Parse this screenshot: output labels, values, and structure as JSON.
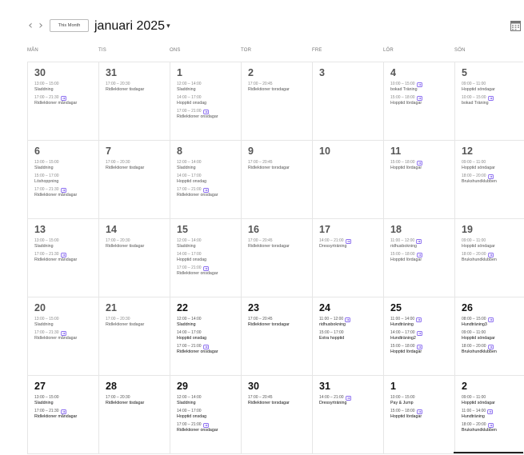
{
  "header": {
    "prev_label": "‹",
    "next_label": "›",
    "this_month_label": "This Month",
    "month_title": "januari 2025",
    "caret": "⌄"
  },
  "weekdays": [
    "MÅN",
    "TIS",
    "ONS",
    "TOR",
    "FRE",
    "LÖR",
    "SÖN"
  ],
  "colors": {
    "accent": "#8a6cf0",
    "grid": "#e6e6e6"
  },
  "weeks": [
    [
      {
        "day": "30",
        "dark": false,
        "events": [
          {
            "time": "13:00 – 15:00",
            "name": "Sladdning",
            "repeat": false
          },
          {
            "time": "17:00 – 21:30",
            "name": "Ridlektioner måndagar",
            "repeat": true
          }
        ]
      },
      {
        "day": "31",
        "dark": false,
        "events": [
          {
            "time": "17:00 – 20:30",
            "name": "Ridlektioner tisdagar",
            "repeat": false
          }
        ]
      },
      {
        "day": "1",
        "dark": false,
        "events": [
          {
            "time": "12:00 – 14:00",
            "name": "Sladdning",
            "repeat": false
          },
          {
            "time": "14:00 – 17:00",
            "name": "Hopptid onsdag",
            "repeat": false
          },
          {
            "time": "17:00 – 21:00",
            "name": "Ridlektioner onsdagar",
            "repeat": true
          }
        ]
      },
      {
        "day": "2",
        "dark": false,
        "events": [
          {
            "time": "17:00 – 20:45",
            "name": "Ridlektioner torsdagar",
            "repeat": false
          }
        ]
      },
      {
        "day": "3",
        "dark": false,
        "events": []
      },
      {
        "day": "4",
        "dark": false,
        "events": [
          {
            "time": "10:00 – 15:00",
            "name": "bokad Träning",
            "repeat": true
          },
          {
            "time": "15:00 – 18:00",
            "name": "Hopptid lördagar",
            "repeat": true
          }
        ]
      },
      {
        "day": "5",
        "dark": false,
        "events": [
          {
            "time": "09:00 – 11:00",
            "name": "Hopptid söndagar",
            "repeat": false
          },
          {
            "time": "10:00 – 15:00",
            "name": "bokad Träning",
            "repeat": true
          }
        ]
      }
    ],
    [
      {
        "day": "6",
        "dark": false,
        "events": [
          {
            "time": "13:00 – 15:00",
            "name": "Sladdning",
            "repeat": false
          },
          {
            "time": "15:00 – 17:00",
            "name": "Löshoppning",
            "repeat": false
          },
          {
            "time": "17:00 – 21:30",
            "name": "Ridlektioner måndagar",
            "repeat": true
          }
        ]
      },
      {
        "day": "7",
        "dark": false,
        "events": [
          {
            "time": "17:00 – 20:30",
            "name": "Ridlektioner tisdagar",
            "repeat": false
          }
        ]
      },
      {
        "day": "8",
        "dark": false,
        "events": [
          {
            "time": "12:00 – 14:00",
            "name": "Sladdning",
            "repeat": false
          },
          {
            "time": "14:00 – 17:00",
            "name": "Hopptid onsdag",
            "repeat": false
          },
          {
            "time": "17:00 – 21:00",
            "name": "Ridlektioner onsdagar",
            "repeat": true
          }
        ]
      },
      {
        "day": "9",
        "dark": false,
        "events": [
          {
            "time": "17:00 – 20:45",
            "name": "Ridlektioner torsdagar",
            "repeat": false
          }
        ]
      },
      {
        "day": "10",
        "dark": false,
        "events": []
      },
      {
        "day": "11",
        "dark": false,
        "events": [
          {
            "time": "15:00 – 18:00",
            "name": "Hopptid lördagar",
            "repeat": true
          }
        ]
      },
      {
        "day": "12",
        "dark": false,
        "events": [
          {
            "time": "09:00 – 11:00",
            "name": "Hopptid söndagar",
            "repeat": false
          },
          {
            "time": "18:00 – 20:00",
            "name": "Brukshundklubben",
            "repeat": true
          }
        ]
      }
    ],
    [
      {
        "day": "13",
        "dark": false,
        "events": [
          {
            "time": "13:00 – 15:00",
            "name": "Sladdning",
            "repeat": false
          },
          {
            "time": "17:00 – 21:30",
            "name": "Ridlektioner måndagar",
            "repeat": true
          }
        ]
      },
      {
        "day": "14",
        "dark": false,
        "events": [
          {
            "time": "17:00 – 20:30",
            "name": "Ridlektioner tisdagar",
            "repeat": false
          }
        ]
      },
      {
        "day": "15",
        "dark": false,
        "events": [
          {
            "time": "12:00 – 14:00",
            "name": "Sladdning",
            "repeat": false
          },
          {
            "time": "14:00 – 17:00",
            "name": "Hopptid onsdag",
            "repeat": false
          },
          {
            "time": "17:00 – 21:00",
            "name": "Ridlektioner onsdagar",
            "repeat": true
          }
        ]
      },
      {
        "day": "16",
        "dark": false,
        "events": [
          {
            "time": "17:00 – 20:45",
            "name": "Ridlektioner torsdagar",
            "repeat": false
          }
        ]
      },
      {
        "day": "17",
        "dark": false,
        "events": [
          {
            "time": "14:00 – 21:00",
            "name": "Dressyrträning",
            "repeat": true
          }
        ]
      },
      {
        "day": "18",
        "dark": false,
        "events": [
          {
            "time": "11:00 – 12:00",
            "name": "ridhusbokning",
            "repeat": true
          },
          {
            "time": "15:00 – 18:00",
            "name": "Hopptid lördagar",
            "repeat": true
          }
        ]
      },
      {
        "day": "19",
        "dark": false,
        "events": [
          {
            "time": "09:00 – 11:00",
            "name": "Hopptid söndagar",
            "repeat": false
          },
          {
            "time": "18:00 – 20:00",
            "name": "Brukshundklubben",
            "repeat": true
          }
        ]
      }
    ],
    [
      {
        "day": "20",
        "dark": false,
        "events": [
          {
            "time": "13:00 – 15:00",
            "name": "Sladdning",
            "repeat": false
          },
          {
            "time": "17:00 – 21:30",
            "name": "Ridlektioner måndagar",
            "repeat": true
          }
        ]
      },
      {
        "day": "21",
        "dark": false,
        "events": [
          {
            "time": "17:00 – 20:30",
            "name": "Ridlektioner tisdagar",
            "repeat": false
          }
        ]
      },
      {
        "day": "22",
        "dark": true,
        "events": [
          {
            "time": "12:00 – 14:00",
            "name": "Sladdning",
            "repeat": false
          },
          {
            "time": "14:00 – 17:00",
            "name": "Hopptid onsdag",
            "repeat": false
          },
          {
            "time": "17:00 – 21:00",
            "name": "Ridlektioner onsdagar",
            "repeat": true
          }
        ]
      },
      {
        "day": "23",
        "dark": true,
        "events": [
          {
            "time": "17:00 – 20:45",
            "name": "Ridlektioner torsdagar",
            "repeat": false
          }
        ]
      },
      {
        "day": "24",
        "dark": true,
        "events": [
          {
            "time": "11:00 – 12:00",
            "name": "ridhusbokning",
            "repeat": true
          },
          {
            "time": "15:00 – 17:00",
            "name": "Extra hopptid",
            "repeat": false
          }
        ]
      },
      {
        "day": "25",
        "dark": true,
        "events": [
          {
            "time": "11:00 – 14:00",
            "name": "Hundträning",
            "repeat": true
          },
          {
            "time": "14:00 – 17:00",
            "name": "Hundträning2",
            "repeat": true
          },
          {
            "time": "15:00 – 18:00",
            "name": "Hopptid lördagar",
            "repeat": true
          }
        ]
      },
      {
        "day": "26",
        "dark": true,
        "events": [
          {
            "time": "08:00 – 15:00",
            "name": "Hundträning3",
            "repeat": true
          },
          {
            "time": "09:00 – 11:00",
            "name": "Hopptid söndagar",
            "repeat": false
          },
          {
            "time": "18:00 – 20:00",
            "name": "Brukshundklubben",
            "repeat": true
          }
        ]
      }
    ],
    [
      {
        "day": "27",
        "dark": true,
        "events": [
          {
            "time": "13:00 – 15:00",
            "name": "Sladdning",
            "repeat": false
          },
          {
            "time": "17:00 – 21:30",
            "name": "Ridlektioner måndagar",
            "repeat": true
          }
        ]
      },
      {
        "day": "28",
        "dark": true,
        "events": [
          {
            "time": "17:00 – 20:30",
            "name": "Ridlektioner tisdagar",
            "repeat": false
          }
        ]
      },
      {
        "day": "29",
        "dark": true,
        "events": [
          {
            "time": "12:00 – 14:00",
            "name": "Sladdning",
            "repeat": false
          },
          {
            "time": "14:00 – 17:00",
            "name": "Hopptid onsdag",
            "repeat": false
          },
          {
            "time": "17:00 – 21:00",
            "name": "Ridlektioner onsdagar",
            "repeat": true
          }
        ]
      },
      {
        "day": "30",
        "dark": true,
        "events": [
          {
            "time": "17:00 – 20:45",
            "name": "Ridlektioner torsdagar",
            "repeat": false
          }
        ]
      },
      {
        "day": "31",
        "dark": true,
        "events": [
          {
            "time": "14:00 – 21:00",
            "name": "Dressyrträning",
            "repeat": true
          }
        ]
      },
      {
        "day": "1",
        "dark": true,
        "events": [
          {
            "time": "10:00 – 15:00",
            "name": "Pay & Jump",
            "repeat": false
          },
          {
            "time": "15:00 – 18:00",
            "name": "Hopptid lördagar",
            "repeat": true
          }
        ]
      },
      {
        "day": "2",
        "dark": true,
        "events": [
          {
            "time": "09:00 – 11:00",
            "name": "Hopptid söndagar",
            "repeat": false
          },
          {
            "time": "11:00 – 14:00",
            "name": "Hundträning",
            "repeat": true
          },
          {
            "time": "18:00 – 20:00",
            "name": "Brukshundklubben",
            "repeat": true
          }
        ]
      }
    ]
  ]
}
